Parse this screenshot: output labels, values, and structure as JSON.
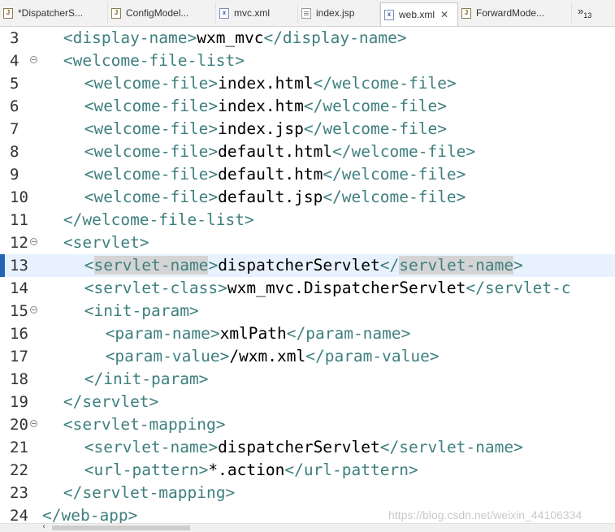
{
  "tabs": [
    {
      "label": "*DispatcherS...",
      "icon": "java-file-icon",
      "active": false,
      "closable": false
    },
    {
      "label": "ConfigModel...",
      "icon": "java-file-icon",
      "active": false,
      "closable": false
    },
    {
      "label": "mvc.xml",
      "icon": "xml-file-icon",
      "active": false,
      "closable": false
    },
    {
      "label": "index.jsp",
      "icon": "jsp-file-icon",
      "active": false,
      "closable": false
    },
    {
      "label": "web.xml",
      "icon": "xml-file-icon",
      "active": true,
      "closable": true
    },
    {
      "label": "ForwardMode...",
      "icon": "java-file-icon",
      "active": false,
      "closable": false
    }
  ],
  "tab_close_glyph": "✕",
  "tab_overflow": {
    "glyph": "»",
    "count": "13"
  },
  "editor": {
    "current_line": "13",
    "lines": [
      {
        "num": "3",
        "fold": "",
        "parts": [
          [
            "tag",
            "<display-name>"
          ],
          [
            "txt",
            "wxm_mvc"
          ],
          [
            "tag",
            "</display-name>"
          ]
        ]
      },
      {
        "num": "4",
        "fold": "⊖",
        "parts": [
          [
            "tag",
            "<welcome-file-list>"
          ]
        ]
      },
      {
        "num": "5",
        "fold": "",
        "parts": [
          [
            "tag",
            "<welcome-file>"
          ],
          [
            "txt",
            "index.html"
          ],
          [
            "tag",
            "</welcome-file>"
          ]
        ]
      },
      {
        "num": "6",
        "fold": "",
        "parts": [
          [
            "tag",
            "<welcome-file>"
          ],
          [
            "txt",
            "index.htm"
          ],
          [
            "tag",
            "</welcome-file>"
          ]
        ]
      },
      {
        "num": "7",
        "fold": "",
        "parts": [
          [
            "tag",
            "<welcome-file>"
          ],
          [
            "txt",
            "index.jsp"
          ],
          [
            "tag",
            "</welcome-file>"
          ]
        ]
      },
      {
        "num": "8",
        "fold": "",
        "parts": [
          [
            "tag",
            "<welcome-file>"
          ],
          [
            "txt",
            "default.html"
          ],
          [
            "tag",
            "</welcome-file>"
          ]
        ]
      },
      {
        "num": "9",
        "fold": "",
        "parts": [
          [
            "tag",
            "<welcome-file>"
          ],
          [
            "txt",
            "default.htm"
          ],
          [
            "tag",
            "</welcome-file>"
          ]
        ]
      },
      {
        "num": "10",
        "fold": "",
        "parts": [
          [
            "tag",
            "<welcome-file>"
          ],
          [
            "txt",
            "default.jsp"
          ],
          [
            "tag",
            "</welcome-file>"
          ]
        ]
      },
      {
        "num": "11",
        "fold": "",
        "parts": [
          [
            "tag",
            "</welcome-file-list>"
          ]
        ]
      },
      {
        "num": "12",
        "fold": "⊖",
        "parts": [
          [
            "tag",
            "<servlet>"
          ]
        ]
      },
      {
        "num": "13",
        "fold": "",
        "parts": [
          [
            "tag",
            "<"
          ],
          [
            "tag-hl",
            "servlet-name"
          ],
          [
            "tag",
            ">"
          ],
          [
            "txt",
            "dispatcherServlet"
          ],
          [
            "tag",
            "</"
          ],
          [
            "tag-hl",
            "servlet-name"
          ],
          [
            "tag",
            ">"
          ]
        ]
      },
      {
        "num": "14",
        "fold": "",
        "parts": [
          [
            "tag",
            "<servlet-class>"
          ],
          [
            "txt",
            "wxm_mvc.DispatcherServlet"
          ],
          [
            "tag",
            "</servlet-c"
          ]
        ]
      },
      {
        "num": "15",
        "fold": "⊖",
        "parts": [
          [
            "tag",
            "<init-param>"
          ]
        ]
      },
      {
        "num": "16",
        "fold": "",
        "parts": [
          [
            "tag",
            "<param-name>"
          ],
          [
            "txt",
            "xmlPath"
          ],
          [
            "tag",
            "</param-name>"
          ]
        ]
      },
      {
        "num": "17",
        "fold": "",
        "parts": [
          [
            "tag",
            "<param-value>"
          ],
          [
            "txt",
            "/wxm.xml"
          ],
          [
            "tag",
            "</param-value>"
          ]
        ]
      },
      {
        "num": "18",
        "fold": "",
        "parts": [
          [
            "tag",
            "</init-param>"
          ]
        ]
      },
      {
        "num": "19",
        "fold": "",
        "parts": [
          [
            "tag",
            "</servlet>"
          ]
        ]
      },
      {
        "num": "20",
        "fold": "⊖",
        "parts": [
          [
            "tag",
            "<servlet-mapping>"
          ]
        ]
      },
      {
        "num": "21",
        "fold": "",
        "parts": [
          [
            "tag",
            "<servlet-name>"
          ],
          [
            "txt",
            "dispatcherServlet"
          ],
          [
            "tag",
            "</servlet-name>"
          ]
        ]
      },
      {
        "num": "22",
        "fold": "",
        "parts": [
          [
            "tag",
            "<url-pattern>"
          ],
          [
            "txt",
            "*.action"
          ],
          [
            "tag",
            "</url-pattern>"
          ]
        ]
      },
      {
        "num": "23",
        "fold": "",
        "parts": [
          [
            "tag",
            "</servlet-mapping>"
          ]
        ]
      },
      {
        "num": "24",
        "fold": "",
        "parts": [
          [
            "tag",
            "</web-app>"
          ]
        ]
      }
    ]
  },
  "watermark": "https://blog.csdn.net/weixin_44106334",
  "colors": {
    "tag": "#3f7f7f",
    "text": "#000000",
    "current_line": "#e8f2fe",
    "occurrence_highlight": "#d4d4d4"
  }
}
